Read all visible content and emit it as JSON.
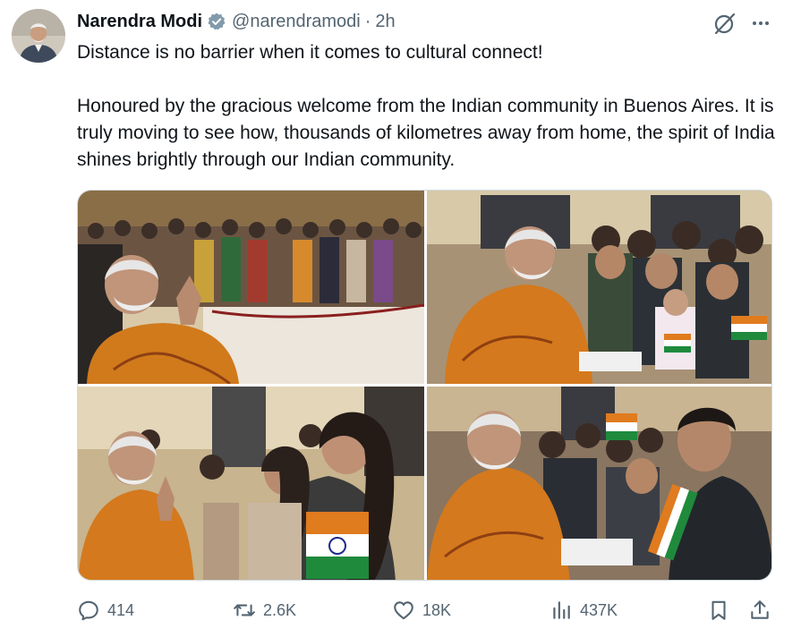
{
  "author": {
    "name": "Narendra Modi",
    "handle": "@narendramodi",
    "separator": "·",
    "time": "2h",
    "verified": true,
    "avatar": "portrait-avatar"
  },
  "header_icons": {
    "grok": "grok-slash-icon",
    "more": "more-dots-icon"
  },
  "tweet": {
    "line1": "Distance is no barrier when it comes to cultural connect!",
    "line2": "Honoured by the gracious welcome from the Indian community in Buenos Aires. It is truly moving to see how, thousands of kilometres away from home, the spirit of India shines brightly through our Indian community."
  },
  "media": {
    "photos": [
      {
        "subject": "leader greeting crowd with folded hands in ornate hall"
      },
      {
        "subject": "leader shaking hands with young people holding flags"
      },
      {
        "subject": "leader greeting women waving Indian flags"
      },
      {
        "subject": "leader smiling with crowd holding Indian flags"
      }
    ]
  },
  "actions": {
    "replies": "414",
    "reposts": "2.6K",
    "likes": "18K",
    "views": "437K"
  },
  "colors": {
    "text": "#0f1419",
    "secondary": "#536471",
    "verified": "#829aab",
    "saffron": "#e07b1e",
    "india_green": "#1f8a3c"
  }
}
